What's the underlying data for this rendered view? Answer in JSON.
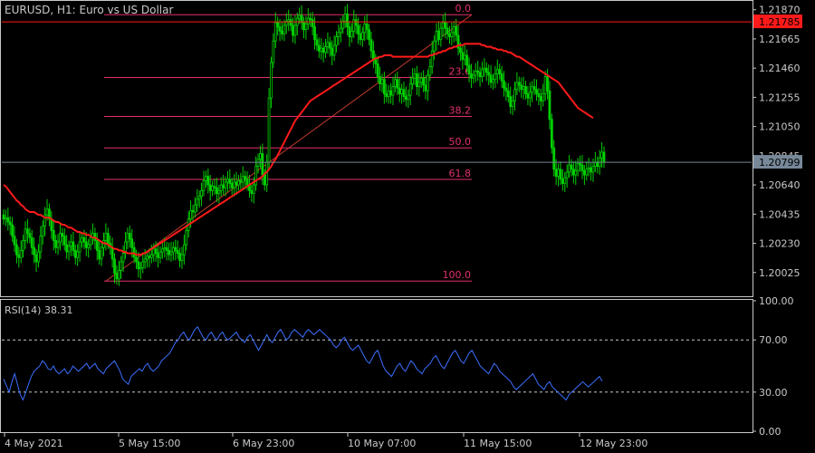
{
  "symbol_label": "EURUSD, H1:  Euro vs US Dollar",
  "colors": {
    "background": "#000000",
    "frame": "#c8c8c8",
    "text": "#c8c8c8",
    "bull_candle": "#00d000",
    "bear_candle": "#00d000",
    "moving_average": "#ff1a1a",
    "fibonacci": "#e0306a",
    "rsi_line": "#3b6fff",
    "ask_line": "#ff1a1a",
    "bid_line": "#778899",
    "level_dash": "#c8c8c8"
  },
  "price_pane": {
    "price_ticks": [
      "1.21870",
      "1.21665",
      "1.21460",
      "1.21255",
      "1.21050",
      "1.20845",
      "1.20640",
      "1.20435",
      "1.20230",
      "1.20025"
    ],
    "ask_label": "1.21785",
    "bid_label": "1.20799"
  },
  "rsi_pane": {
    "label": "RSI(14) 38.31",
    "ticks": [
      "100.00",
      "70.00",
      "30.00",
      "0.00"
    ],
    "levels": [
      70,
      30
    ]
  },
  "time_axis": [
    "4 May 2021",
    "5 May 15:00",
    "6 May 23:00",
    "10 May 07:00",
    "11 May 15:00",
    "12 May 23:00"
  ],
  "chart_data": [
    {
      "type": "candlestick",
      "title": "EURUSD, H1:  Euro vs US Dollar",
      "ylim": [
        1.1989,
        1.219
      ],
      "ask": 1.21785,
      "bid": 1.20799,
      "fibonacci": {
        "from": {
          "x": "5 May 01:00",
          "y": 1.19965
        },
        "to": {
          "x": "11 May 15:00",
          "y": 1.21835
        },
        "levels": [
          {
            "label": "0.0",
            "value": 1.21835
          },
          {
            "label": "23.6",
            "value": 1.21394
          },
          {
            "label": "38.2",
            "value": 1.21121
          },
          {
            "label": "50.0",
            "value": 1.209
          },
          {
            "label": "61.8",
            "value": 1.20679
          },
          {
            "label": "100.0",
            "value": 1.19965
          }
        ]
      },
      "candles": {
        "x_label_anchors": [
          "4 May 2021",
          "5 May 15:00",
          "6 May 23:00",
          "10 May 07:00",
          "11 May 15:00",
          "12 May 23:00"
        ],
        "close": [
          1.204,
          1.2041,
          1.2038,
          1.2036,
          1.2028,
          1.2022,
          1.2015,
          1.2013,
          1.2018,
          1.2025,
          1.2033,
          1.203,
          1.2027,
          1.202,
          1.2015,
          1.201,
          1.2017,
          1.2028,
          1.2035,
          1.2043,
          1.2047,
          1.204,
          1.2032,
          1.2025,
          1.202,
          1.2024,
          1.203,
          1.2028,
          1.2022,
          1.2017,
          1.2021,
          1.2024,
          1.2018,
          1.2013,
          1.2017,
          1.2024,
          1.2027,
          1.2024,
          1.202,
          1.2022,
          1.2027,
          1.203,
          1.2025,
          1.2018,
          1.2012,
          1.202,
          1.2025,
          1.203,
          1.2023,
          1.202,
          1.2012,
          1.2002,
          1.1998,
          1.2004,
          1.201,
          1.2016,
          1.2024,
          1.203,
          1.2026,
          1.202,
          1.2013,
          1.201,
          1.2005,
          1.2006,
          1.201,
          1.2012,
          1.2014,
          1.2013,
          1.2015,
          1.2019,
          1.2016,
          1.2013,
          1.2017,
          1.2019,
          1.202,
          1.2018,
          1.2015,
          1.2017,
          1.202,
          1.2018,
          1.2016,
          1.2011,
          1.2015,
          1.2022,
          1.2032,
          1.204,
          1.2046,
          1.2045,
          1.205,
          1.2054,
          1.2056,
          1.206,
          1.2067,
          1.207,
          1.2064,
          1.206,
          1.2063,
          1.2062,
          1.2058,
          1.206,
          1.2064,
          1.2062,
          1.2066,
          1.2068,
          1.2065,
          1.2062,
          1.2066,
          1.2064,
          1.2067,
          1.2066,
          1.207,
          1.2068,
          1.2064,
          1.206,
          1.2058,
          1.2064,
          1.2077,
          1.2082,
          1.2086,
          1.2071,
          1.2064,
          1.208,
          1.2125,
          1.215,
          1.2165,
          1.2178,
          1.2175,
          1.2172,
          1.217,
          1.2176,
          1.2179,
          1.218,
          1.2176,
          1.2169,
          1.2176,
          1.2181,
          1.2183,
          1.2178,
          1.2173,
          1.2177,
          1.2181,
          1.218,
          1.2175,
          1.2166,
          1.2162,
          1.2158,
          1.216,
          1.2157,
          1.2161,
          1.2164,
          1.216,
          1.2155,
          1.2162,
          1.2168,
          1.2171,
          1.2174,
          1.2179,
          1.2184,
          1.2175,
          1.2168,
          1.2172,
          1.218,
          1.2176,
          1.217,
          1.2166,
          1.2171,
          1.2177,
          1.2173,
          1.2166,
          1.2158,
          1.2152,
          1.2149,
          1.214,
          1.2135,
          1.2138,
          1.2128,
          1.2126,
          1.213,
          1.2127,
          1.2133,
          1.2138,
          1.2132,
          1.2128,
          1.2131,
          1.2126,
          1.2124,
          1.2127,
          1.2135,
          1.2139,
          1.2142,
          1.2133,
          1.2136,
          1.2139,
          1.2134,
          1.213,
          1.2141,
          1.2147,
          1.2158,
          1.2165,
          1.2172,
          1.2166,
          1.2174,
          1.2178,
          1.2174,
          1.217,
          1.2168,
          1.2171,
          1.2175,
          1.2169,
          1.216,
          1.2157,
          1.2152,
          1.2155,
          1.2148,
          1.2142,
          1.2139,
          1.2141,
          1.2144,
          1.2143,
          1.214,
          1.2145,
          1.2146,
          1.2143,
          1.2141,
          1.2136,
          1.2138,
          1.2142,
          1.2145,
          1.2142,
          1.2137,
          1.2132,
          1.213,
          1.2126,
          1.2119,
          1.2123,
          1.2131,
          1.2136,
          1.2134,
          1.2131,
          1.2133,
          1.2128,
          1.2125,
          1.2129,
          1.2133,
          1.2131,
          1.2128,
          1.2126,
          1.2123,
          1.2128,
          1.214,
          1.213,
          1.211,
          1.209,
          1.2075,
          1.207,
          1.2075,
          1.2068,
          1.2065,
          1.2069,
          1.2073,
          1.2078,
          1.2075,
          1.2071,
          1.2074,
          1.2079,
          1.2078,
          1.2074,
          1.2071,
          1.2075,
          1.2076,
          1.2073,
          1.2077,
          1.208,
          1.2077,
          1.2083,
          1.2087,
          1.208
        ],
        "ma_values": [
          1.2064,
          1.2063,
          1.2061,
          1.2059,
          1.2057,
          1.2055,
          1.2053,
          1.2052,
          1.205,
          1.2049,
          1.2047,
          1.2046,
          1.2045,
          1.2045,
          1.2045,
          1.2044,
          1.2043,
          1.2043,
          1.2042,
          1.2041,
          1.2041,
          1.2041,
          1.204,
          1.2039,
          1.2038,
          1.2038,
          1.2037,
          1.2036,
          1.2036,
          1.2035,
          1.2034,
          1.2034,
          1.2033,
          1.2032,
          1.2031,
          1.2031,
          1.203,
          1.203,
          1.2029,
          1.2029,
          1.2028,
          1.2027,
          1.2027,
          1.2026,
          1.2025,
          1.2024,
          1.2023,
          1.2023,
          1.2022,
          1.2021,
          1.202,
          1.2019,
          1.2019,
          1.2018,
          1.2018,
          1.2017,
          1.2017,
          1.2016,
          1.2016,
          1.2016,
          1.2016,
          1.2015,
          1.2015,
          1.2015,
          1.2016,
          1.2016,
          1.2017,
          1.2018,
          1.2019,
          1.202,
          1.2021,
          1.2022,
          1.2023,
          1.2024,
          1.2025,
          1.2026,
          1.2027,
          1.2028,
          1.2029,
          1.203,
          1.2031,
          1.2032,
          1.2033,
          1.2034,
          1.2035,
          1.2036,
          1.2037,
          1.2038,
          1.2039,
          1.204,
          1.2041,
          1.2042,
          1.2043,
          1.2044,
          1.2045,
          1.2046,
          1.2047,
          1.2048,
          1.2049,
          1.205,
          1.2051,
          1.2052,
          1.2053,
          1.2054,
          1.2055,
          1.2056,
          1.2057,
          1.2058,
          1.2059,
          1.206,
          1.2061,
          1.2062,
          1.2063,
          1.2064,
          1.2065,
          1.2066,
          1.2067,
          1.2068,
          1.2069,
          1.207,
          1.2072,
          1.2073,
          1.2075,
          1.2077,
          1.208,
          1.2082,
          1.2085,
          1.2088,
          1.2091,
          1.2094,
          1.2097,
          1.21,
          1.2103,
          1.2106,
          1.2109,
          1.2111,
          1.2113,
          1.2115,
          1.2117,
          1.2119,
          1.2121,
          1.2123,
          1.2124,
          1.2125,
          1.2126,
          1.2127,
          1.2128,
          1.2129,
          1.213,
          1.2131,
          1.2132,
          1.2133,
          1.2134,
          1.2135,
          1.2136,
          1.2137,
          1.2138,
          1.2139,
          1.214,
          1.2141,
          1.2142,
          1.2143,
          1.2144,
          1.2145,
          1.2146,
          1.2147,
          1.2148,
          1.2149,
          1.215,
          1.2151,
          1.2152,
          1.2153,
          1.2153,
          1.2154,
          1.2154,
          1.2155,
          1.2155,
          1.2155,
          1.2155,
          1.2154,
          1.2154,
          1.2154,
          1.2154,
          1.2154,
          1.2154,
          1.2154,
          1.2154,
          1.2154,
          1.2154,
          1.2154,
          1.2154,
          1.2154,
          1.2154,
          1.2154,
          1.2154,
          1.2154,
          1.2155,
          1.2155,
          1.2156,
          1.2156,
          1.2157,
          1.2157,
          1.2158,
          1.2158,
          1.2159,
          1.216,
          1.216,
          1.2161,
          1.2161,
          1.2162,
          1.2162,
          1.2162,
          1.2163,
          1.2163,
          1.2163,
          1.2163,
          1.2163,
          1.2163,
          1.2163,
          1.2163,
          1.2162,
          1.2162,
          1.2161,
          1.2161,
          1.2161,
          1.216,
          1.216,
          1.2159,
          1.2159,
          1.2159,
          1.2158,
          1.2158,
          1.2157,
          1.2157,
          1.2156,
          1.2155,
          1.2154,
          1.2154,
          1.2153,
          1.2152,
          1.2151,
          1.215,
          1.2149,
          1.2148,
          1.2147,
          1.2146,
          1.2145,
          1.2144,
          1.2143,
          1.2142,
          1.2141,
          1.214,
          1.2139,
          1.2138,
          1.2137,
          1.2136,
          1.2134,
          1.2132,
          1.213,
          1.2128,
          1.2126,
          1.2124,
          1.2122,
          1.212,
          1.2118,
          1.2117,
          1.2116,
          1.2115,
          1.2114,
          1.2113,
          1.2112,
          1.2111
        ]
      }
    },
    {
      "type": "line",
      "title": "RSI(14) 38.31",
      "ylim": [
        0,
        100
      ],
      "levels": [
        70,
        30
      ],
      "last_value": 38.31,
      "series": [
        {
          "values": [
            40,
            35,
            30,
            38,
            44,
            36,
            28,
            24,
            30,
            36,
            42,
            46,
            48,
            50,
            54,
            52,
            48,
            47,
            50,
            46,
            44,
            46,
            48,
            44,
            46,
            50,
            48,
            46,
            48,
            50,
            52,
            48,
            50,
            52,
            48,
            46,
            44,
            48,
            50,
            52,
            54,
            50,
            46,
            40,
            38,
            36,
            42,
            44,
            46,
            48,
            46,
            50,
            52,
            48,
            46,
            48,
            50,
            54,
            56,
            58,
            60,
            64,
            68,
            70,
            74,
            76,
            72,
            70,
            74,
            78,
            80,
            76,
            72,
            70,
            74,
            76,
            72,
            70,
            74,
            76,
            72,
            70,
            72,
            74,
            76,
            72,
            70,
            68,
            72,
            74,
            70,
            66,
            62,
            66,
            70,
            74,
            70,
            68,
            72,
            76,
            78,
            74,
            70,
            72,
            76,
            78,
            76,
            74,
            72,
            76,
            78,
            76,
            74,
            76,
            78,
            76,
            74,
            72,
            70,
            66,
            64,
            66,
            70,
            72,
            68,
            64,
            62,
            64,
            66,
            62,
            58,
            54,
            52,
            56,
            60,
            62,
            56,
            50,
            46,
            44,
            42,
            46,
            50,
            52,
            48,
            46,
            50,
            54,
            52,
            48,
            46,
            44,
            48,
            50,
            52,
            56,
            58,
            54,
            50,
            48,
            52,
            56,
            60,
            62,
            58,
            54,
            52,
            56,
            60,
            62,
            58,
            54,
            50,
            48,
            46,
            44,
            48,
            52,
            50,
            46,
            44,
            42,
            40,
            38,
            34,
            32,
            34,
            36,
            38,
            40,
            42,
            44,
            40,
            36,
            34,
            32,
            36,
            38,
            34,
            32,
            30,
            28,
            26,
            24,
            28,
            30,
            32,
            34,
            36,
            38,
            36,
            34,
            36,
            38,
            40,
            42,
            38.31
          ]
        }
      ]
    }
  ]
}
